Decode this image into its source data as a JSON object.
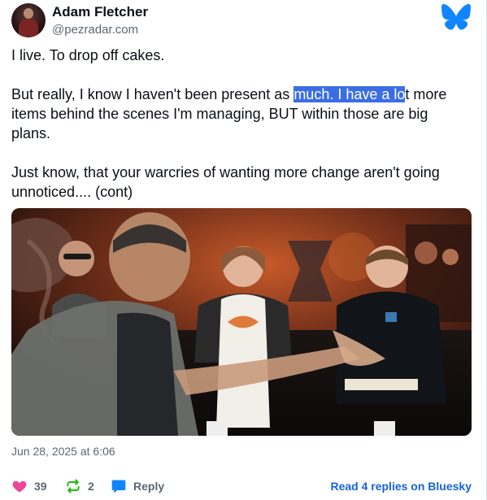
{
  "author": {
    "display_name": "Adam Fletcher",
    "handle": "@pezradar.com"
  },
  "post": {
    "paragraphs": [
      {
        "parts": [
          {
            "text": "I live. To drop off cakes.",
            "highlight": false
          }
        ]
      },
      {
        "parts": [
          {
            "text": "But really, I know I haven't been present as ",
            "highlight": false
          },
          {
            "text": "much. I have a lo",
            "highlight": true
          },
          {
            "text": "t more items behind the scenes I'm managing, BUT within those are big plans.",
            "highlight": false
          }
        ]
      },
      {
        "parts": [
          {
            "text": "Just know, that your warcries of wanting more change aren't going unnoticed.... (cont)",
            "highlight": false
          }
        ]
      }
    ],
    "timestamp": "Jun 28, 2025 at 6:06"
  },
  "actions": {
    "likes": "39",
    "reposts": "2",
    "reply_label": "Reply",
    "read_replies_label": "Read 4 replies on Bluesky"
  },
  "icons": {
    "logo": "bluesky-butterfly-icon",
    "like": "heart-icon",
    "repost": "repost-icon",
    "reply": "speech-bubble-icon"
  },
  "colors": {
    "brand": "#1185fe",
    "like": "#ec4899",
    "repost": "#20bc07",
    "link": "#1563d6",
    "selection": "#3b6ee3",
    "muted": "#5b6772"
  }
}
